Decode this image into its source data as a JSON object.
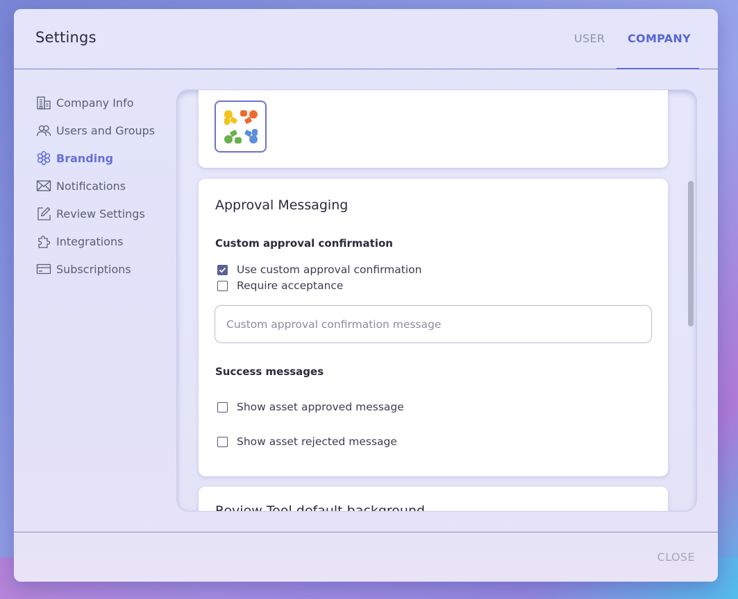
{
  "dialog": {
    "title": "Settings",
    "tabs": [
      {
        "label": "USER",
        "active": false
      },
      {
        "label": "COMPANY",
        "active": true
      }
    ],
    "close_label": "CLOSE"
  },
  "sidebar": {
    "items": [
      {
        "label": "Company Info",
        "icon": "building-icon",
        "active": false
      },
      {
        "label": "Users and Groups",
        "icon": "users-icon",
        "active": false
      },
      {
        "label": "Branding",
        "icon": "flower-icon",
        "active": true
      },
      {
        "label": "Notifications",
        "icon": "envelope-icon",
        "active": false
      },
      {
        "label": "Review Settings",
        "icon": "edit-icon",
        "active": false
      },
      {
        "label": "Integrations",
        "icon": "puzzle-icon",
        "active": false
      },
      {
        "label": "Subscriptions",
        "icon": "card-icon",
        "active": false
      }
    ]
  },
  "branding": {
    "logo_icon": "company-logo-icon",
    "approval": {
      "title": "Approval Messaging",
      "custom_section": "Custom approval confirmation",
      "use_custom_label": "Use custom approval confirmation",
      "use_custom_checked": true,
      "require_acceptance_label": "Require acceptance",
      "require_acceptance_checked": false,
      "message_placeholder": "Custom approval confirmation message",
      "message_value": "",
      "success_section": "Success messages",
      "show_approved_label": "Show asset approved message",
      "show_approved_checked": false,
      "show_rejected_label": "Show asset rejected message",
      "show_rejected_checked": false
    },
    "review_tool_title": "Review Tool default background"
  },
  "colors": {
    "accent": "#5f6ad6",
    "checkbox_checked": "#5c6196"
  }
}
